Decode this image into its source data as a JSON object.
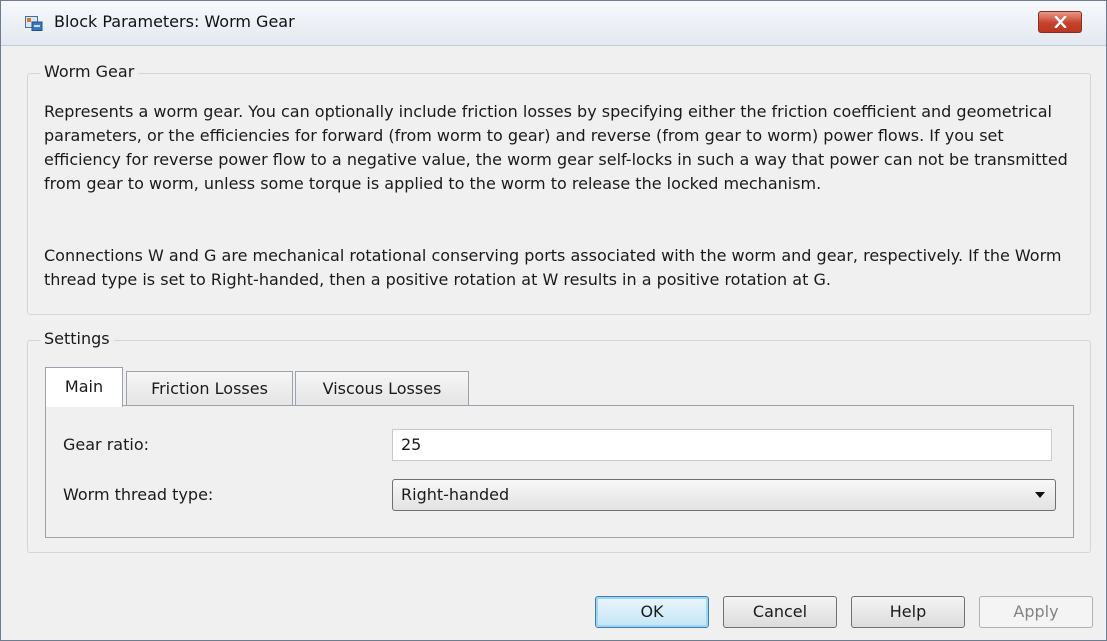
{
  "window": {
    "title": "Block Parameters: Worm Gear",
    "app_icon": "simulink-block-icon",
    "close_icon": "close-icon"
  },
  "description": {
    "group_title": "Worm Gear",
    "paragraph1": "Represents a worm gear. You can optionally include friction losses by specifying either the friction coefficient and geometrical parameters, or the efficiencies for forward (from worm to gear) and reverse (from gear to worm) power flows. If you set efficiency for reverse power flow to a negative value, the worm gear self-locks in such a way that power can not be transmitted from gear to worm, unless some torque is applied to the worm to release the locked mechanism.",
    "paragraph2": "Connections W and G are mechanical rotational conserving ports associated with the worm and gear, respectively. If the Worm thread type is set to Right-handed, then a positive rotation at W results in a positive rotation at G."
  },
  "settings": {
    "group_title": "Settings",
    "tabs": [
      {
        "label": "Main",
        "active": true
      },
      {
        "label": "Friction Losses",
        "active": false
      },
      {
        "label": "Viscous Losses",
        "active": false
      }
    ],
    "gear_ratio": {
      "label": "Gear ratio:",
      "value": "25"
    },
    "worm_thread_type": {
      "label": "Worm thread type:",
      "selected": "Right-handed"
    }
  },
  "buttons": {
    "ok": "OK",
    "cancel": "Cancel",
    "help": "Help",
    "apply": "Apply"
  },
  "colors": {
    "close_button": "#c8412b",
    "default_button_border": "#3c7fb1",
    "dialog_background": "#f0f0f0"
  }
}
